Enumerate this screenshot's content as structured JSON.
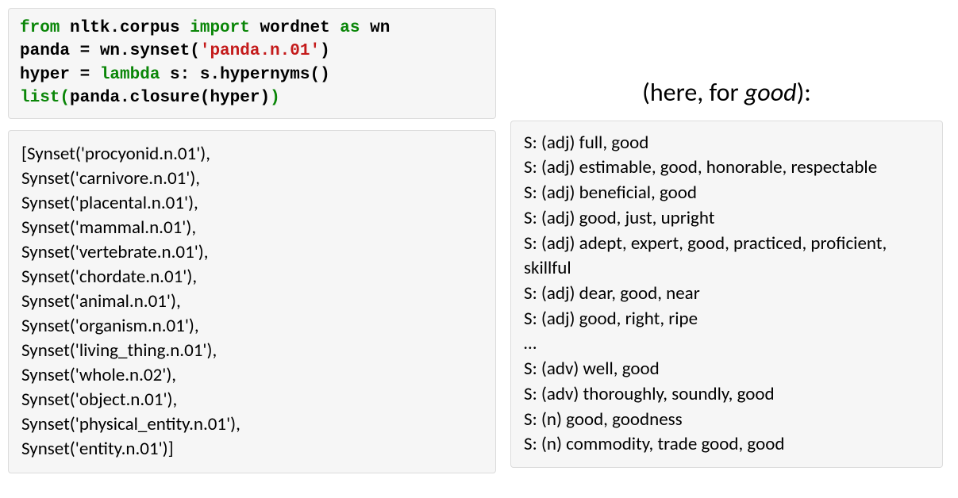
{
  "code": {
    "line1_kw1": "from",
    "line1_mid": " nltk.corpus ",
    "line1_kw2": "import",
    "line1_rest": " wordnet ",
    "line1_kw3": "as",
    "line1_end": " wn",
    "line2_a": "panda = wn.synset(",
    "line2_str": "'panda.n.01'",
    "line2_b": ")",
    "line3_a": "hyper = ",
    "line3_kw": "lambda",
    "line3_b": " s: s.hypernyms()",
    "line4_kw": "list",
    "line4_paren1": "(",
    "line4_mid": "panda.closure(hyper)",
    "line4_paren2": ")"
  },
  "output": {
    "lines": [
      "[Synset('procyonid.n.01'),",
      "Synset('carnivore.n.01'),",
      "Synset('placental.n.01'),",
      "Synset('mammal.n.01'),",
      "Synset('vertebrate.n.01'),",
      "Synset('chordate.n.01'),",
      "Synset('animal.n.01'),",
      "Synset('organism.n.01'),",
      "Synset('living_thing.n.01'),",
      "Synset('whole.n.02'),",
      "Synset('object.n.01'),",
      "Synset('physical_entity.n.01'),",
      "Synset('entity.n.01')]"
    ]
  },
  "heading": {
    "pre": "(here, for ",
    "word": "good",
    "post": "):"
  },
  "good_synsets": [
    "S: (adj) full, good",
    "S: (adj) estimable, good, honorable, respectable",
    "S: (adj) beneficial, good",
    "S: (adj) good, just, upright",
    "S: (adj) adept, expert, good, practiced, proficient, skillful",
    "S: (adj) dear, good, near",
    "S: (adj) good, right, ripe",
    "…",
    "S: (adv) well, good",
    "S: (adv) thoroughly, soundly, good",
    "S: (n) good, goodness",
    "S: (n) commodity, trade good, good"
  ]
}
